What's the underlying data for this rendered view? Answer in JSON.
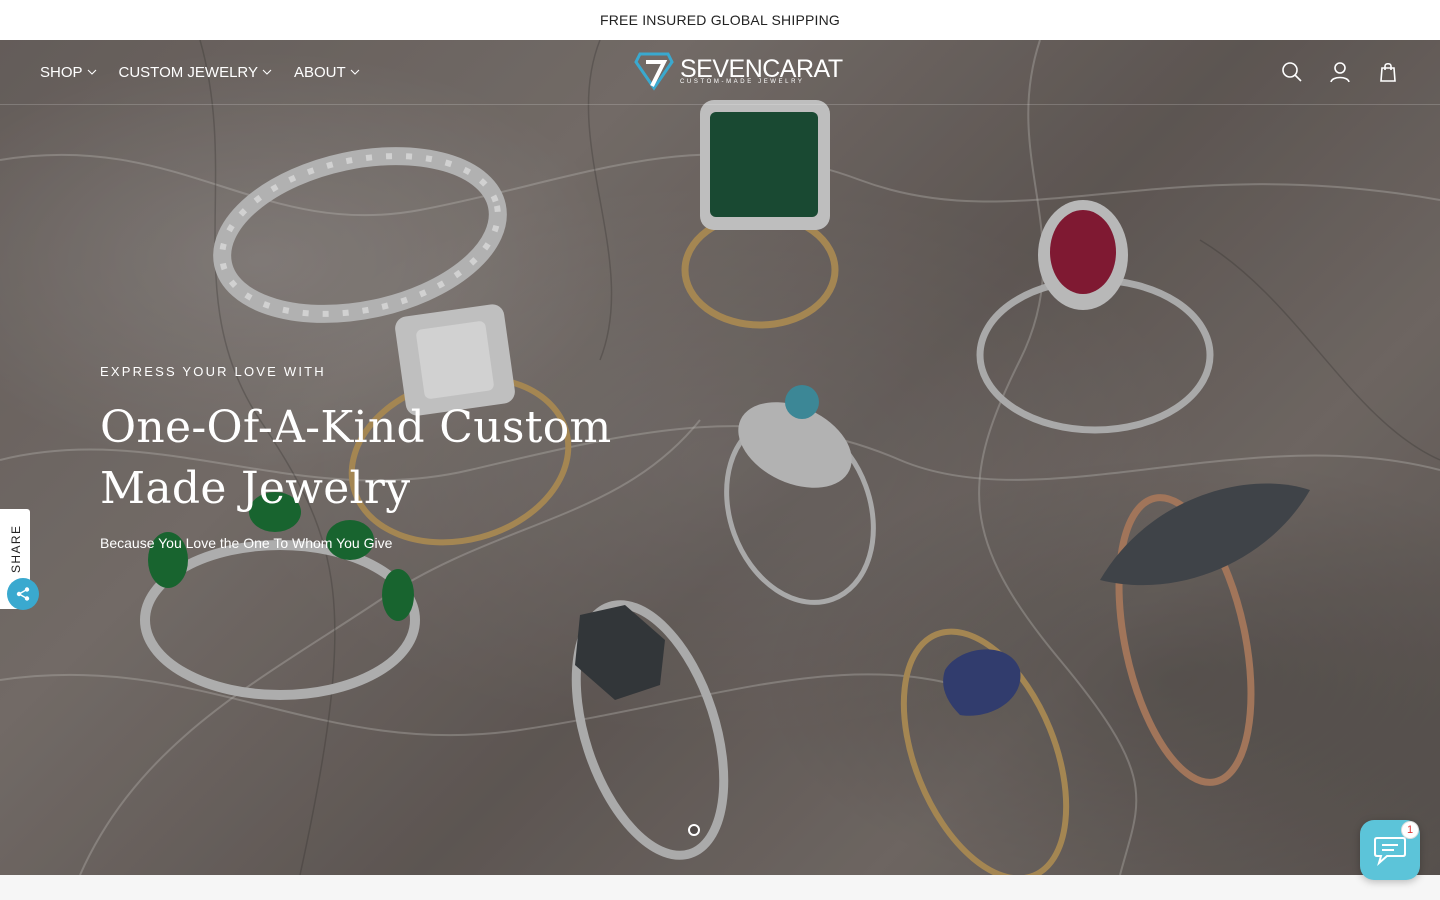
{
  "announcement": {
    "text": "FREE INSURED GLOBAL SHIPPING"
  },
  "nav": {
    "items": [
      {
        "label": "SHOP"
      },
      {
        "label": "CUSTOM JEWELRY"
      },
      {
        "label": "ABOUT"
      }
    ]
  },
  "logo": {
    "name": "SEVENCARAT",
    "tagline": "CUSTOM-MADE JEWELRY"
  },
  "header_icons": [
    "search-icon",
    "account-icon",
    "cart-icon"
  ],
  "hero": {
    "eyebrow": "EXPRESS YOUR LOVE WITH",
    "title": "One-Of-A-Kind Custom Made Jewelry",
    "subtitle": "Because You Love the One To Whom You Give"
  },
  "share": {
    "label": "SHARE"
  },
  "slider": {
    "slide_count": 1,
    "active_index": 0
  },
  "chat": {
    "unread_count": "1"
  },
  "colors": {
    "accent": "#3aa9cf",
    "chat": "#5cc4d9",
    "announcement_bg": "#ffffff",
    "text_light": "#ffffff"
  }
}
